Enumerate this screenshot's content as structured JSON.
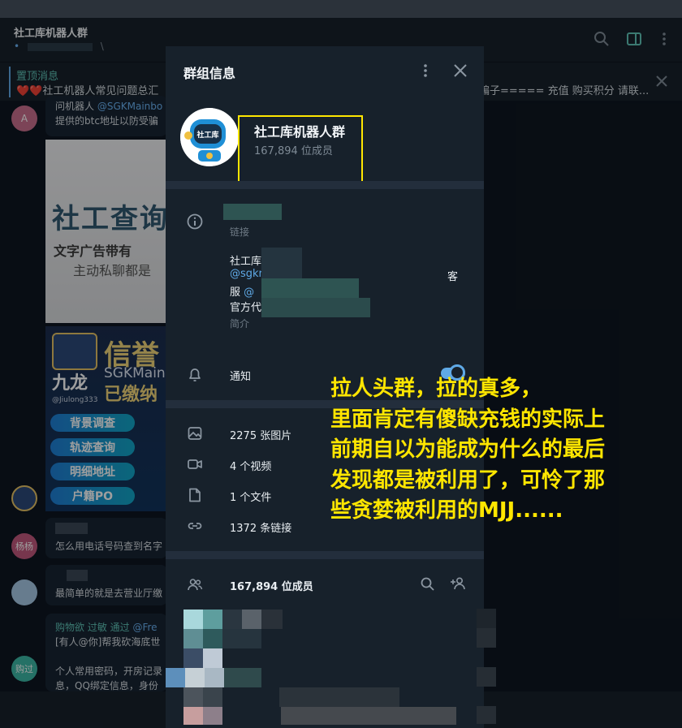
{
  "chat": {
    "title": "社工库机器人群",
    "subtitle": "•",
    "subtitle_extra": "\\"
  },
  "pinned": {
    "title": "置顶消息",
    "text": "❤️❤️社工机器人常见问题总汇",
    "text_right": "骗子===== 充值 购买积分 请联..."
  },
  "messages": {
    "m1_line1_prefix": "问机器人 ",
    "m1_line1_mention": "@SGKMainbo",
    "m1_line2": "提供的btc地址以防受骗",
    "m1_avatar": "A",
    "banner1_title": "社工查询",
    "banner1_sub": "文字广告带有",
    "banner1_sub2": "主动私聊都是",
    "banner2_name": "信誉",
    "banner2_sgk": "SGKMain",
    "banner2_paid": "已缴纳",
    "banner2_dragon": "九龙",
    "banner2_user": "@Jiulong333",
    "banner2_btn1": "背景调查",
    "banner2_btn2": "轨迹查询",
    "banner2_btn3": "明细地址",
    "banner2_btn4": "户籍PO",
    "m2_avatar": "杨杨",
    "m2_text": "怎么用电话号码查到名字",
    "m3_text": "最简单的就是去营业厅缴",
    "m4_avatar": "购过",
    "m4_line1_a": "购物欲 过敏 通过 ",
    "m4_line1_b": "@Fre",
    "m4_line2": "[有人@你]帮我砍海底世",
    "m4_line3": "个人常用密码，开房记录",
    "m4_line4": "息，QQ绑定信息，身份"
  },
  "modal": {
    "title": "群组信息",
    "group_name": "社工库机器人群",
    "member_count": "167,894 位成员",
    "link_caption": "链接",
    "desc_line1": "社工库",
    "desc_line2": "@sgkr",
    "desc_line3_a": "服  ",
    "desc_line3_b": "@",
    "desc_line4": "官方代",
    "desc_right": "客",
    "desc_caption": "简介",
    "notify_label": "通知",
    "notify_on": true,
    "media": [
      {
        "icon": "image-icon",
        "label": "2275 张图片"
      },
      {
        "icon": "video-icon",
        "label": "4 个视频"
      },
      {
        "icon": "file-icon",
        "label": "1 个文件"
      },
      {
        "icon": "link-icon",
        "label": "1372 条链接"
      }
    ],
    "members_label": "167,894 位成员"
  },
  "annotation": {
    "lines": [
      "拉人头群，拉的真多，",
      "里面肯定有傻缺充钱的实际上",
      "前期自以为能成为什么的最后",
      "发现都是被利用了，可怜了那",
      "些贪婪被利用的MJJ......"
    ]
  },
  "colors": {
    "accent": "#5fa9e6",
    "highlight": "#ffe600",
    "panel_bg": "#17212b"
  }
}
